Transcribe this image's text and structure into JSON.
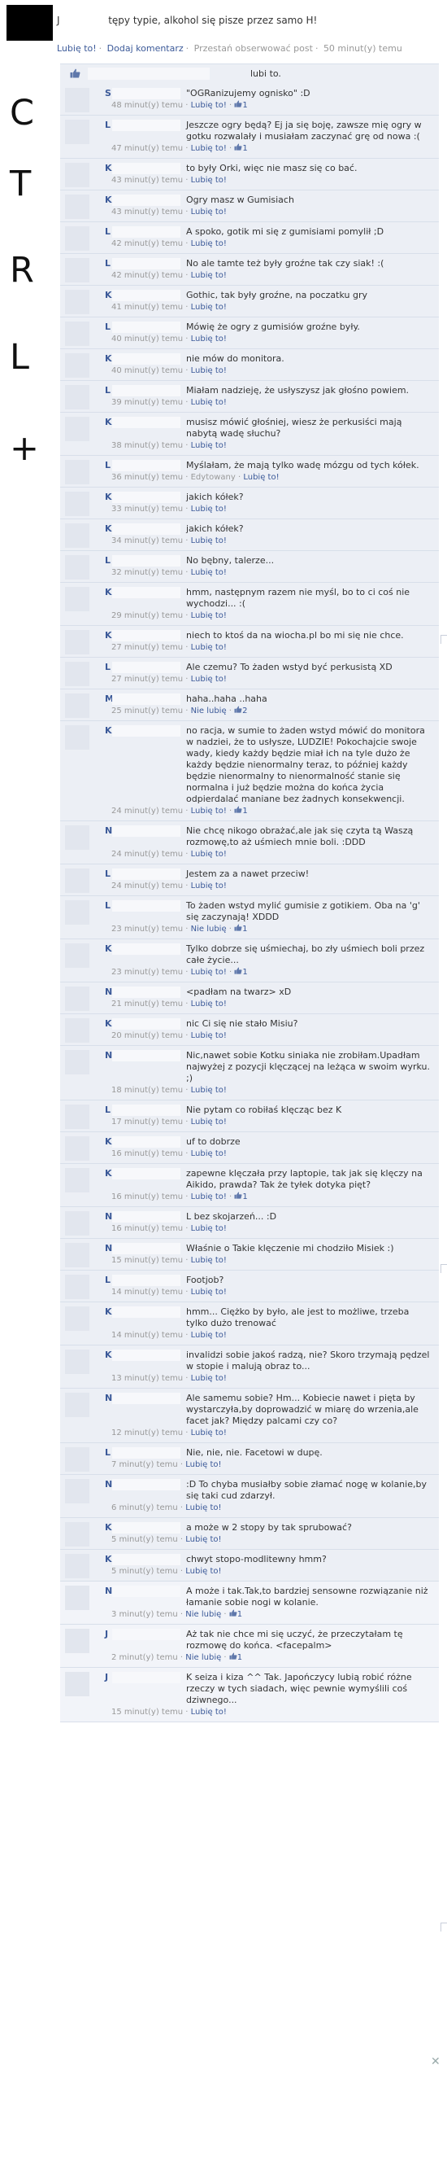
{
  "post": {
    "initial": "J",
    "text": "tępy typie, alkohol się pisze przez samo H!",
    "actions": [
      "Lubię to!",
      "Dodaj komentarz",
      "Przestań obserwować post",
      "50 minut(y) temu"
    ]
  },
  "sidebar_letters": [
    "C",
    "T",
    "R",
    "L",
    "+"
  ],
  "likes_text": "lubi to.",
  "like_label": "Lubię to!",
  "unlike_label": "Nie lubię",
  "comments": [
    {
      "initial": "S",
      "text": "\"OGRanizujemy ognisko\" :D",
      "time": "48 minut(y) temu",
      "likes": "1",
      "liked": false
    },
    {
      "initial": "L",
      "text": "Jeszcze ogry będą? Ej ja się boję, zawsze mię ogry w gotku rozwalały i musiałam zaczynać grę od nowa :(",
      "time": "47 minut(y) temu",
      "likes": "1",
      "liked": false
    },
    {
      "initial": "K",
      "text": "to były Orki, więc nie masz się co bać.",
      "time": "43 minut(y) temu",
      "likes": "",
      "liked": false
    },
    {
      "initial": "K",
      "text": "Ogry masz w Gumisiach",
      "time": "43 minut(y) temu",
      "likes": "",
      "liked": false
    },
    {
      "initial": "L",
      "text": "A spoko, gotik mi się z gumisiami pomylił ;D",
      "time": "42 minut(y) temu",
      "likes": "",
      "liked": false
    },
    {
      "initial": "L",
      "text": "No ale tamte też były groźne tak czy siak! :(",
      "time": "42 minut(y) temu",
      "likes": "",
      "liked": false
    },
    {
      "initial": "K",
      "text": "Gothic, tak były groźne, na poczatku gry",
      "time": "41 minut(y) temu",
      "likes": "",
      "liked": false
    },
    {
      "initial": "L",
      "text": "Mówię że ogry z gumisiów groźne były.",
      "time": "40 minut(y) temu",
      "likes": "",
      "liked": false
    },
    {
      "initial": "K",
      "text": "nie mów do monitora.",
      "time": "40 minut(y) temu",
      "likes": "",
      "liked": false
    },
    {
      "initial": "L",
      "text": "Miałam nadzieję, że usłyszysz jak głośno powiem.",
      "time": "39 minut(y) temu",
      "likes": "",
      "liked": false
    },
    {
      "initial": "K",
      "text": "musisz mówić głośniej, wiesz że perkusiści mają nabytą wadę słuchu?",
      "time": "38 minut(y) temu",
      "likes": "",
      "liked": false
    },
    {
      "initial": "L",
      "text": "Myślałam, że mają tylko wadę mózgu od tych kółek.",
      "time": "36 minut(y) temu · Edytowany",
      "likes": "",
      "liked": false
    },
    {
      "initial": "K",
      "text": "jakich kółek?",
      "time": "33 minut(y) temu",
      "likes": "",
      "liked": false
    },
    {
      "initial": "K",
      "text": "jakich kółek?",
      "time": "34 minut(y) temu",
      "likes": "",
      "liked": false
    },
    {
      "initial": "L",
      "text": "No bębny, talerze...",
      "time": "32 minut(y) temu",
      "likes": "",
      "liked": false
    },
    {
      "initial": "K",
      "text": "hmm, następnym razem nie myśl, bo to ci coś nie wychodzi... :(",
      "time": "29 minut(y) temu",
      "likes": "",
      "liked": false
    },
    {
      "initial": "K",
      "text": "niech to ktoś da na wiocha.pl bo mi się nie chce.",
      "time": "27 minut(y) temu",
      "likes": "",
      "liked": false
    },
    {
      "initial": "L",
      "text": "Ale czemu? To żaden wstyd być perkusistą XD",
      "time": "27 minut(y) temu",
      "likes": "",
      "liked": false
    },
    {
      "initial": "M",
      "text": "haha..haha ..haha",
      "time": "25 minut(y) temu",
      "likes": "2",
      "liked": true
    },
    {
      "initial": "K",
      "text": "no racja, w sumie to żaden wstyd mówić do monitora w nadziei, że to usłysze, LUDZIE! Pokochajcie swoje wady, kiedy każdy będzie miał ich na tyle dużo że każdy będzie nienormalny teraz, to później każdy będzie nienormalny to nienormalność stanie się normalna i już będzie można do końca życia odpierdalać maniane bez żadnych konsekwencji.",
      "time": "24 minut(y) temu",
      "likes": "1",
      "liked": false
    },
    {
      "initial": "N",
      "text": "Nie chcę nikogo obrażać,ale jak się czyta tą Waszą rozmowę,to aż uśmiech mnie boli. :DDD",
      "time": "24 minut(y) temu",
      "likes": "",
      "liked": false
    },
    {
      "initial": "L",
      "text": "Jestem za a nawet przeciw!",
      "time": "24 minut(y) temu",
      "likes": "",
      "liked": false
    },
    {
      "initial": "L",
      "text": "To żaden wstyd mylić gumisie z gotikiem. Oba na 'g' się zaczynają! XDDD",
      "time": "23 minut(y) temu",
      "likes": "1",
      "liked": true
    },
    {
      "initial": "K",
      "text": "Tylko dobrze się uśmiechaj, bo zły uśmiech boli przez całe życie...",
      "time": "23 minut(y) temu",
      "likes": "1",
      "liked": false
    },
    {
      "initial": "N",
      "text": "<padłam na twarz> xD",
      "time": "21 minut(y) temu",
      "likes": "",
      "liked": false
    },
    {
      "initial": "K",
      "text": "nic Ci się nie stało Misiu?",
      "time": "20 minut(y) temu",
      "likes": "",
      "liked": false
    },
    {
      "initial": "N",
      "text": "Nic,nawet sobie Kotku siniaka nie zrobiłam.Upadłam najwyżej z pozycji klęczącej na leżąca w swoim wyrku. ;)",
      "time": "18 minut(y) temu",
      "likes": "",
      "liked": false
    },
    {
      "initial": "L",
      "text": "Nie pytam co robiłaś klęcząc bez K",
      "time": "17 minut(y) temu",
      "likes": "",
      "liked": false
    },
    {
      "initial": "K",
      "text": "uf to dobrze",
      "time": "16 minut(y) temu",
      "likes": "",
      "liked": false
    },
    {
      "initial": "K",
      "text": "zapewne klęczała przy laptopie, tak jak się klęczy na Aikido, prawda? Tak że tyłek dotyka pięt?",
      "time": "16 minut(y) temu",
      "likes": "1",
      "liked": false
    },
    {
      "initial": "N",
      "text": "L bez skojarzeń... :D",
      "time": "16 minut(y) temu",
      "likes": "",
      "liked": false
    },
    {
      "initial": "N",
      "text": "Właśnie o Takie klęczenie mi chodziło Misiek :)",
      "time": "15 minut(y) temu",
      "likes": "",
      "liked": false
    },
    {
      "initial": "L",
      "text": "Footjob?",
      "time": "14 minut(y) temu",
      "likes": "",
      "liked": false
    },
    {
      "initial": "K",
      "text": "hmm... Ciężko by było, ale jest to możliwe, trzeba tylko dużo trenować",
      "time": "14 minut(y) temu",
      "likes": "",
      "liked": false
    },
    {
      "initial": "K",
      "text": "invalidzi sobie jakoś radzą, nie? Skoro trzymają pędzel w stopie i malują obraz to...",
      "time": "13 minut(y) temu",
      "likes": "",
      "liked": false
    },
    {
      "initial": "N",
      "text": "Ale samemu sobie? Hm... Kobiecie nawet i pięta by wystarczyła,by doprowadzić w miarę do wrzenia,ale facet jak? Między palcami czy co?",
      "time": "12 minut(y) temu",
      "likes": "",
      "liked": false
    },
    {
      "initial": "L",
      "text": "Nie, nie, nie. Facetowi w dupę.",
      "time": "7 minut(y) temu",
      "likes": "",
      "liked": false
    },
    {
      "initial": "N",
      "text": ":D To chyba musiałby sobie złamać nogę w kolanie,by się taki cud zdarzył.",
      "time": "6 minut(y) temu",
      "likes": "",
      "liked": false
    },
    {
      "initial": "K",
      "text": "a może w 2 stopy by tak sprubować?",
      "time": "5 minut(y) temu",
      "likes": "",
      "liked": false
    },
    {
      "initial": "K",
      "text": "chwyt stopo-modlitewny hmm?",
      "time": "5 minut(y) temu",
      "likes": "",
      "liked": false
    },
    {
      "initial": "N",
      "text": "A może i tak.Tak,to bardziej sensowne rozwiązanie niż łamanie sobie nogi w kolanie.",
      "time": "3 minut(y) temu",
      "likes": "1",
      "liked": true
    },
    {
      "initial": "J",
      "text": "Aż tak nie chce mi się uczyć, że przeczytałam tę rozmowę do końca. <facepalm>",
      "time": "2 minut(y) temu",
      "likes": "1",
      "liked": true
    },
    {
      "initial": "J",
      "text": "K seiza i kiza ^^ Tak. Japończycy lubią robić różne rzeczy w tych siadach, więc pewnie wymyślili coś dziwnego...",
      "time": "15 minut(y) temu",
      "likes": "",
      "liked": false
    }
  ]
}
